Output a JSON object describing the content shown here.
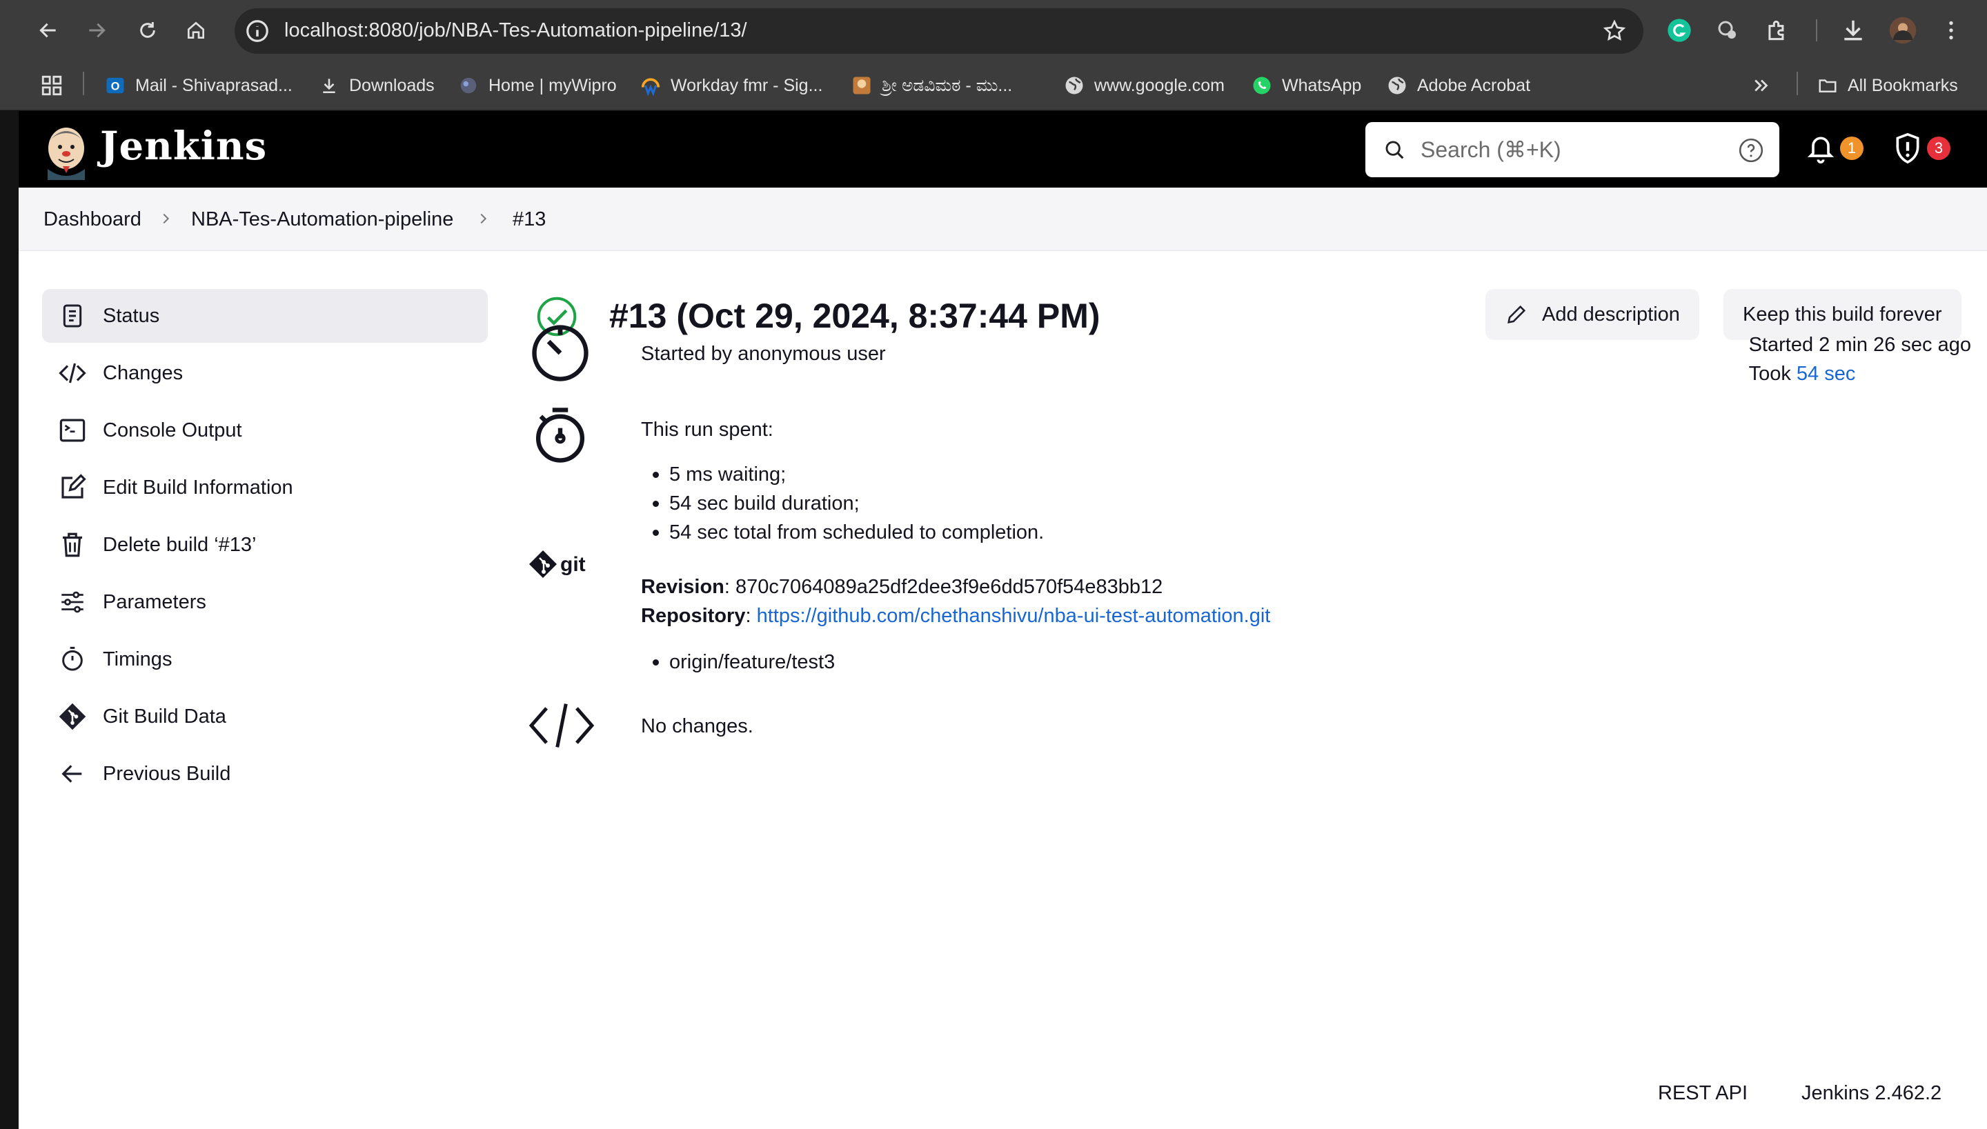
{
  "browser": {
    "url": "localhost:8080/job/NBA-Tes-Automation-pipeline/13/",
    "bookmarks": [
      {
        "label": "Mail - Shivaprasad...",
        "icon": "outlook-icon"
      },
      {
        "label": "Downloads",
        "icon": "download-icon"
      },
      {
        "label": "Home | myWipro",
        "icon": "wipro-icon"
      },
      {
        "label": "Workday fmr - Sig...",
        "icon": "workday-icon"
      },
      {
        "label": "ಶ್ರೀ ಅಡವಿಮಠ - ಮು...",
        "icon": "temple-icon"
      },
      {
        "label": "www.google.com",
        "icon": "globe-icon"
      },
      {
        "label": "WhatsApp",
        "icon": "whatsapp-icon"
      },
      {
        "label": "Adobe Acrobat",
        "icon": "globe-icon"
      }
    ],
    "all_bookmarks": "All Bookmarks"
  },
  "header": {
    "brand": "Jenkins",
    "search_placeholder": "Search (⌘+K)",
    "notifications_count": "1",
    "security_count": "3",
    "colors": {
      "notification": "#f0932b",
      "security": "#e6313c"
    }
  },
  "breadcrumbs": [
    "Dashboard",
    "NBA-Tes-Automation-pipeline",
    "#13"
  ],
  "sidebar": {
    "items": [
      {
        "label": "Status",
        "icon": "document-icon"
      },
      {
        "label": "Changes",
        "icon": "code-icon"
      },
      {
        "label": "Console Output",
        "icon": "terminal-icon"
      },
      {
        "label": "Edit Build Information",
        "icon": "edit-icon"
      },
      {
        "label": "Delete build ‘#13’",
        "icon": "trash-icon"
      },
      {
        "label": "Parameters",
        "icon": "sliders-icon"
      },
      {
        "label": "Timings",
        "icon": "stopwatch-icon"
      },
      {
        "label": "Git Build Data",
        "icon": "git-icon"
      },
      {
        "label": "Previous Build",
        "icon": "arrow-left-icon"
      }
    ]
  },
  "build": {
    "title": "#13 (Oct 29, 2024, 8:37:44 PM)",
    "add_description": "Add description",
    "keep_forever": "Keep this build forever",
    "started_by": "Started by anonymous user",
    "started_ago": "Started 2 min 26 sec ago",
    "took_prefix": "Took ",
    "took_value": "54 sec",
    "run_spent_label": "This run spent:",
    "run_spent": [
      "5 ms waiting;",
      "54 sec build duration;",
      "54 sec total from scheduled to completion."
    ],
    "revision_label": "Revision",
    "revision": "870c7064089a25df2dee3f9e6dd570f54e83bb12",
    "repository_label": "Repository",
    "repository_url": "https://github.com/chethanshivu/nba-ui-test-automation.git",
    "branches": [
      "origin/feature/test3"
    ],
    "no_changes": "No changes.",
    "status_color": "#1ea446"
  },
  "footer": {
    "rest_api": "REST API",
    "version": "Jenkins 2.462.2"
  }
}
